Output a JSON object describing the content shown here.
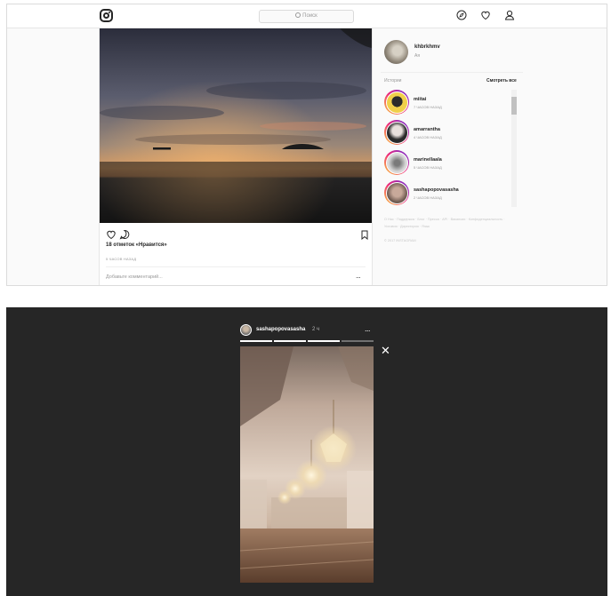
{
  "feed": {
    "search": {
      "placeholder": "Поиск"
    },
    "post": {
      "likes": "18 отметок «Нравится»",
      "time": "5 часов назад",
      "comment_placeholder": "Добавьте комментарий...",
      "more": "..."
    },
    "profile": {
      "username": "khbrkhmv",
      "subtitle": "Ая"
    },
    "stories": {
      "header": "Истории",
      "see_all": "Смотреть все",
      "items": [
        {
          "username": "miitai",
          "time": "7 часов назад"
        },
        {
          "username": "amarrantha",
          "time": "4 часов назад"
        },
        {
          "username": "marinellaala",
          "time": "5 часов назад"
        },
        {
          "username": "sashapopovasasha",
          "time": "2 часов назад"
        }
      ]
    },
    "footer": {
      "links": "О Нас · Поддержка · Блог · Пресса · API · Вакансии · Конфиденциальность · Условия · Директория · Язык",
      "copyright": "© 2017 Instagram"
    }
  },
  "story_viewer": {
    "username": "sashapopovasasha",
    "time": "2 ч",
    "more": "...",
    "close": "✕",
    "progress": {
      "segments": 4,
      "completed": 3
    }
  },
  "icons": [
    "instagram-logo-icon",
    "search-icon",
    "compass-icon",
    "heart-icon",
    "profile-icon",
    "like-icon",
    "comment-icon",
    "bookmark-icon",
    "close-icon"
  ],
  "colors": {
    "story_ring": "#ee2a7b",
    "dark_bg": "#262626"
  }
}
